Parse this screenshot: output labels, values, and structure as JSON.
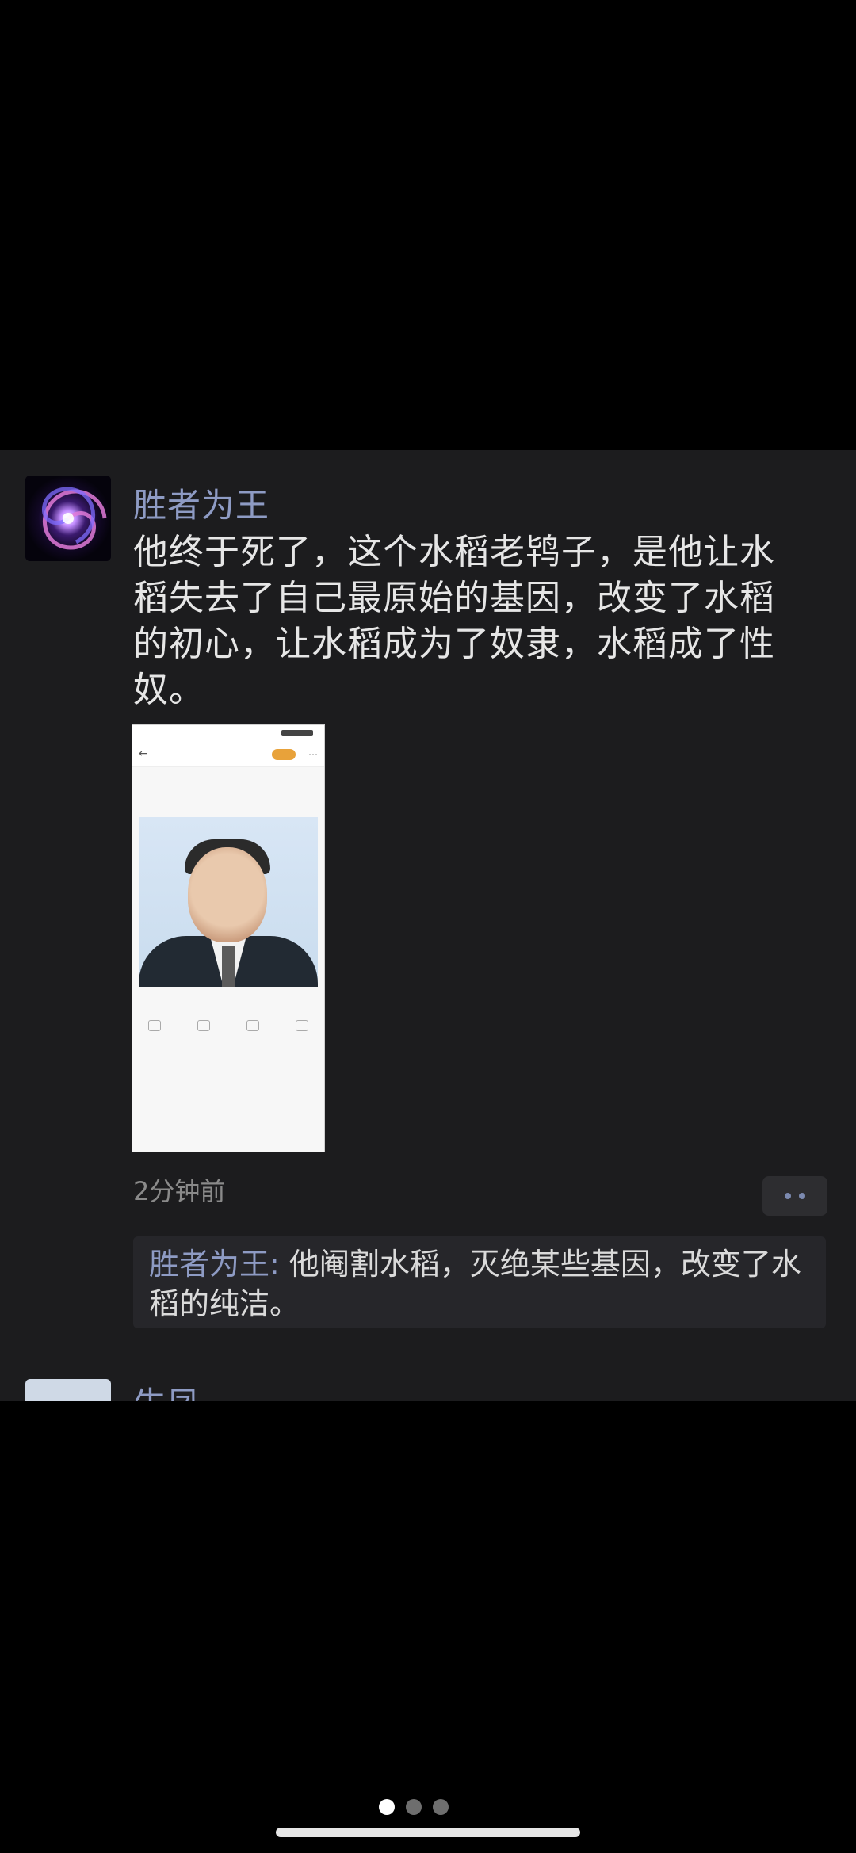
{
  "post": {
    "username": "胜者为王",
    "text": "他终于死了，这个水稻老鸨子，是他让水稻失去了自己最原始的基因，改变了水稻的初心，让水稻成为了奴隶，水稻成了性奴。",
    "time": "2分钟前"
  },
  "comment": {
    "author": "胜者为王:",
    "text": "他阉割水稻，灭绝某些基因，改变了水稻的纯洁。"
  },
  "next_post": {
    "username": "牛凤"
  },
  "icons": {
    "avatar": "galaxy-swirl-avatar",
    "more": "two-dots-icon"
  },
  "colors": {
    "background": "#000000",
    "card": "#1c1c1e",
    "username": "#8e9bc4",
    "text": "#e6e6e6"
  },
  "pager": {
    "pages": 3,
    "active_index": 0
  }
}
